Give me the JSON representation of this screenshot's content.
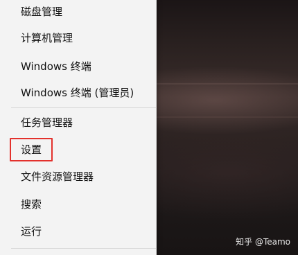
{
  "context_menu": {
    "items": [
      {
        "id": "disk-management",
        "label": "磁盘管理"
      },
      {
        "id": "computer-management",
        "label": "计算机管理"
      },
      {
        "id": "windows-terminal",
        "label": "Windows 终端"
      },
      {
        "id": "windows-terminal-admin",
        "label": "Windows 终端 (管理员)"
      },
      {
        "id": "task-manager",
        "label": "任务管理器"
      },
      {
        "id": "settings",
        "label": "设置"
      },
      {
        "id": "file-explorer",
        "label": "文件资源管理器"
      },
      {
        "id": "search",
        "label": "搜索"
      },
      {
        "id": "run",
        "label": "运行"
      }
    ]
  },
  "annotation": {
    "highlight_color": "#e3312c",
    "highlighted_item": "设置"
  },
  "watermark": {
    "text": "知乎 @Teamo"
  },
  "colors": {
    "menu_background": "#f3f3f3",
    "menu_text": "#111111",
    "separator": "#d9d9d9"
  }
}
